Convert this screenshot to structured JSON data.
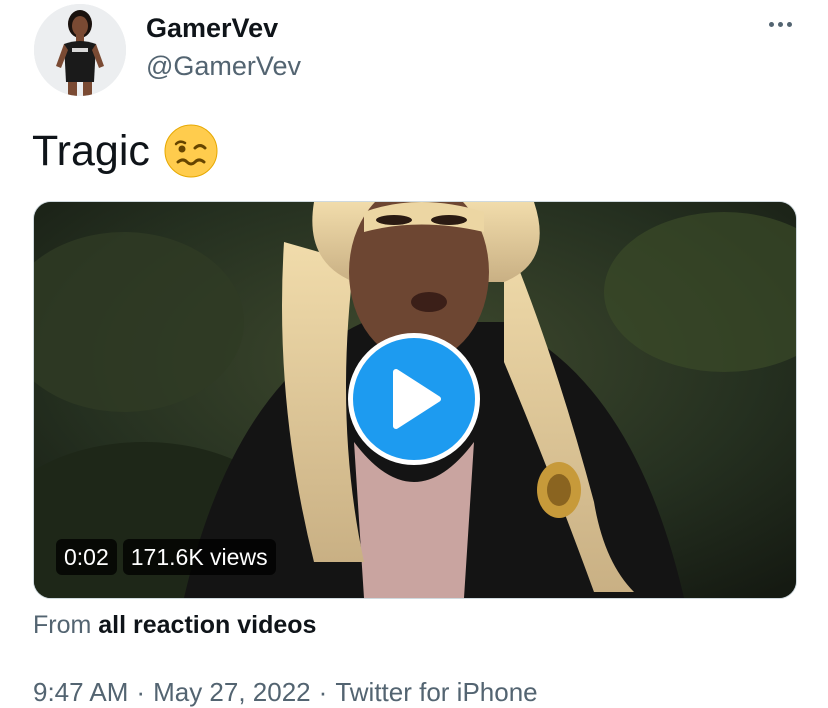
{
  "author": {
    "display_name": "GamerVev",
    "handle": "@GamerVev",
    "avatar_icon": "profile-photo"
  },
  "tweet": {
    "text": "Tragic",
    "emoji": "woozy-face-emoji"
  },
  "media": {
    "duration": "0:02",
    "views": "171.6K views",
    "play_icon": "play-icon",
    "accent": "#1d9bf0"
  },
  "source": {
    "prefix": "From",
    "link": "all reaction videos"
  },
  "meta": {
    "time": "9:47 AM",
    "separator": "·",
    "date": "May 27, 2022",
    "client": "Twitter for iPhone"
  },
  "colors": {
    "secondary_text": "#536471",
    "primary_text": "#0f1419"
  }
}
